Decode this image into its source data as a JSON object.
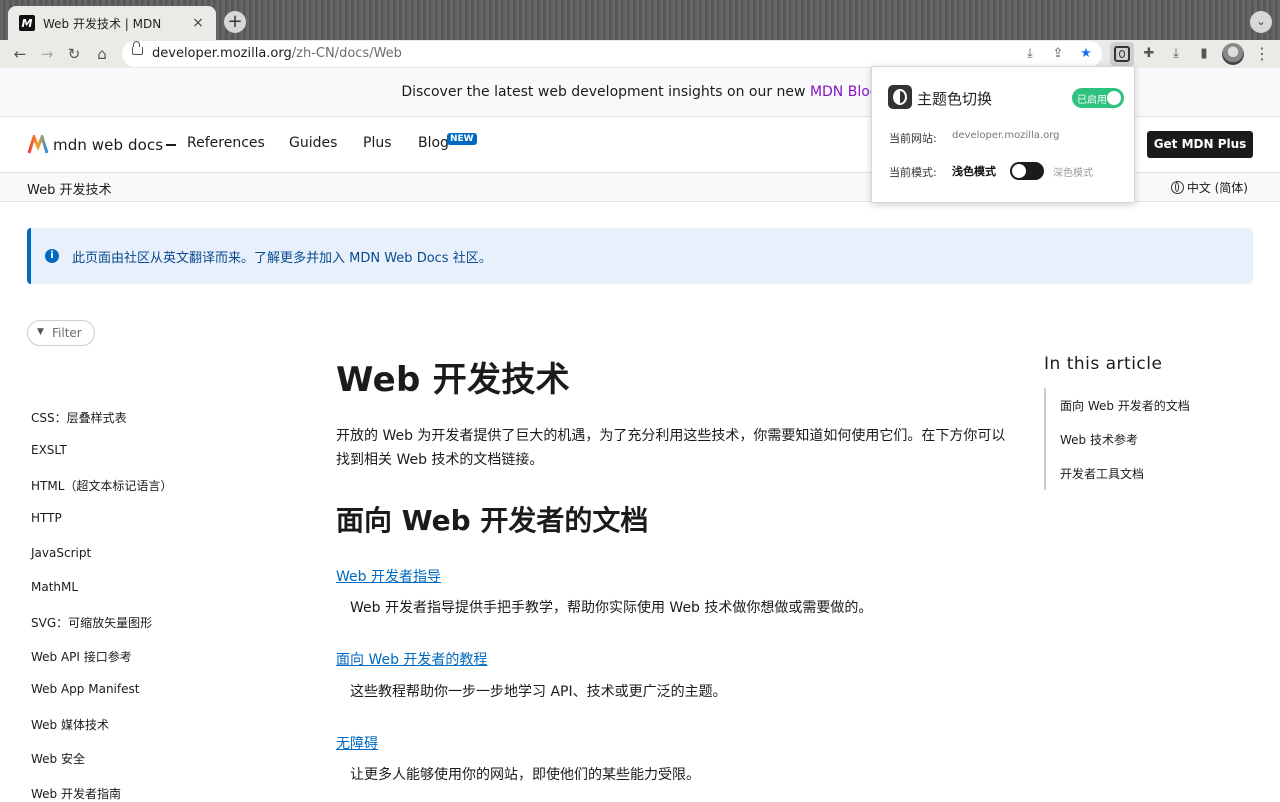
{
  "browser": {
    "tab_title": "Web 开发技术 | MDN",
    "favicon_letter": "M",
    "url_host": "developer.mozilla.org",
    "url_path": "/zh-CN/docs/Web",
    "icons": {
      "back": "arrow-left-icon",
      "forward": "arrow-right-icon",
      "reload": "reload-icon",
      "home": "home-icon",
      "lock": "lock-icon",
      "install": "install-icon",
      "share": "share-icon",
      "bookmark": "star-icon",
      "extensions": "puzzle-icon",
      "download": "download-icon",
      "sidepanel": "sidepanel-icon",
      "menu": "kebab-menu-icon"
    },
    "accent": "#1a73e8"
  },
  "banner": {
    "text": "Discover the latest web development insights on our new ",
    "link": "MDN Blog"
  },
  "header": {
    "logo_text": "mdn web docs",
    "nav": [
      "References",
      "Guides",
      "Plus",
      "Blog"
    ],
    "new_badge": "NEW",
    "cta": "Get MDN Plus"
  },
  "crumb": {
    "current": "Web 开发技术",
    "language": "中文 (简体)"
  },
  "notice": {
    "text": "此页面由社区从英文翻译而来。了解更多并加入 MDN Web Docs 社区。"
  },
  "sidebar": {
    "filter_placeholder": "Filter",
    "items": [
      "CSS：层叠样式表",
      "EXSLT",
      "HTML（超文本标记语言）",
      "HTTP",
      "JavaScript",
      "MathML",
      "SVG：可缩放矢量图形",
      "Web API 接口参考",
      "Web App Manifest",
      "Web 媒体技术",
      "Web 安全",
      "Web 开发者指南"
    ]
  },
  "article": {
    "title": "Web 开发技术",
    "intro": "开放的 Web 为开发者提供了巨大的机遇，为了充分利用这些技术，你需要知道如何使用它们。在下方你可以找到相关 Web 技术的文档链接。",
    "section_title": "面向 Web 开发者的文档",
    "entries": [
      {
        "link": "Web 开发者指导",
        "desc": "Web 开发者指导提供手把手教学，帮助你实际使用 Web 技术做你想做或需要做的。"
      },
      {
        "link": "面向 Web 开发者的教程",
        "desc": "这些教程帮助你一步一步地学习 API、技术或更广泛的主题。"
      },
      {
        "link": "无障碍",
        "desc": "让更多人能够使用你的网站，即使他们的某些能力受限。"
      }
    ]
  },
  "toc": {
    "title": "In this article",
    "items": [
      "面向 Web 开发者的文档",
      "Web 技术参考",
      "开发者工具文档"
    ]
  },
  "popup": {
    "title": "主题色切换",
    "enabled_label": "已启用",
    "enabled": true,
    "site_label": "当前网站:",
    "site_value": "developer.mozilla.org",
    "mode_label": "当前模式:",
    "light_label": "浅色模式",
    "dark_label": "深色模式",
    "accent": "#2ec27e"
  }
}
